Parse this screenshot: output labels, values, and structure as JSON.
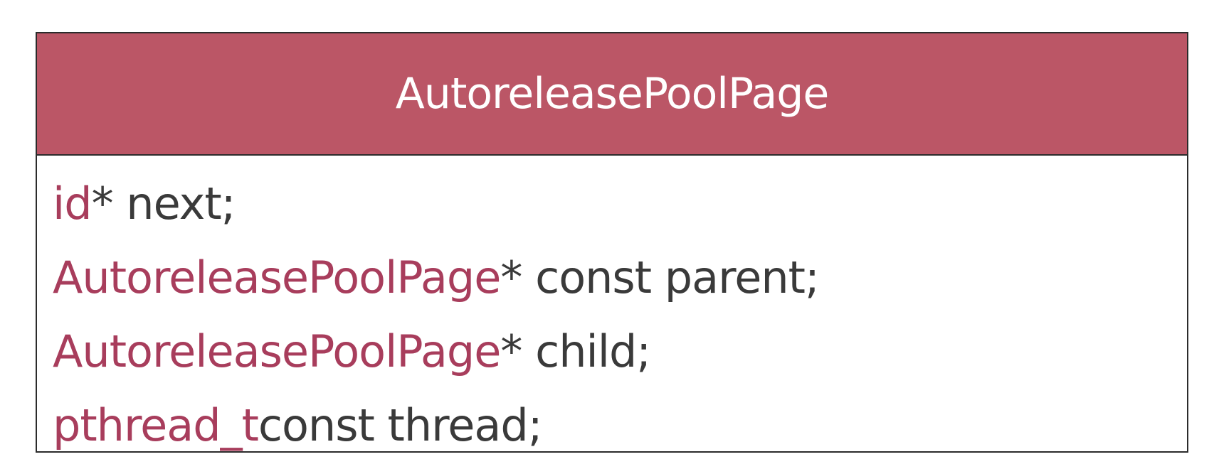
{
  "colors": {
    "header_bg": "#bb5666",
    "type_text": "#a83d5c",
    "plain_text": "#3a3a3a",
    "border": "#2b2b2b"
  },
  "class_name": "AutoreleasePoolPage",
  "fields": [
    {
      "type": "id",
      "rest": "* next;"
    },
    {
      "type": "AutoreleasePoolPage",
      "rest": "* const parent;"
    },
    {
      "type": "AutoreleasePoolPage",
      "rest": "* child;"
    },
    {
      "type": "pthread_t",
      "rest": " const thread;"
    }
  ]
}
